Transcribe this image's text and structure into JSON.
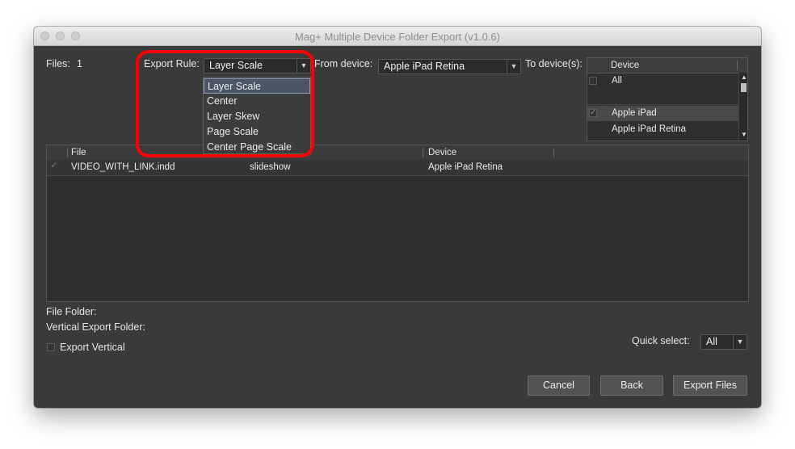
{
  "window": {
    "title": "Mag+ Multiple Device Folder Export (v1.0.6)"
  },
  "files": {
    "label": "Files:",
    "count": "1"
  },
  "export_rule": {
    "label": "Export Rule:",
    "selected": "Layer Scale",
    "options": [
      "Layer Scale",
      "Center",
      "Layer Skew",
      "Page Scale",
      "Center Page Scale"
    ]
  },
  "from_device": {
    "label": "From device:",
    "selected": "Apple iPad Retina"
  },
  "to_devices": {
    "label": "To device(s):",
    "column": "Device",
    "items": [
      {
        "label": "All",
        "checked": false
      },
      {
        "label": "",
        "checked": false
      },
      {
        "label": "Apple iPad",
        "checked": true
      },
      {
        "label": "Apple iPad Retina",
        "checked": false
      }
    ]
  },
  "table": {
    "columns": [
      "File",
      "",
      "Device"
    ],
    "rows": [
      {
        "checked": true,
        "file": "VIDEO_WITH_LINK.indd",
        "folder": "slideshow",
        "device": "Apple iPad Retina"
      }
    ]
  },
  "file_folder": {
    "label": "File Folder:"
  },
  "vertical_export_folder": {
    "label": "Vertical Export Folder:"
  },
  "export_vertical": {
    "label": "Export Vertical",
    "checked": false
  },
  "quick_select": {
    "label": "Quick select:",
    "selected": "All"
  },
  "buttons": {
    "cancel": "Cancel",
    "back": "Back",
    "export": "Export Files"
  },
  "colors": {
    "highlight": "#ff0000",
    "window_bg": "#3a3a3a",
    "selection": "#4c5566"
  }
}
